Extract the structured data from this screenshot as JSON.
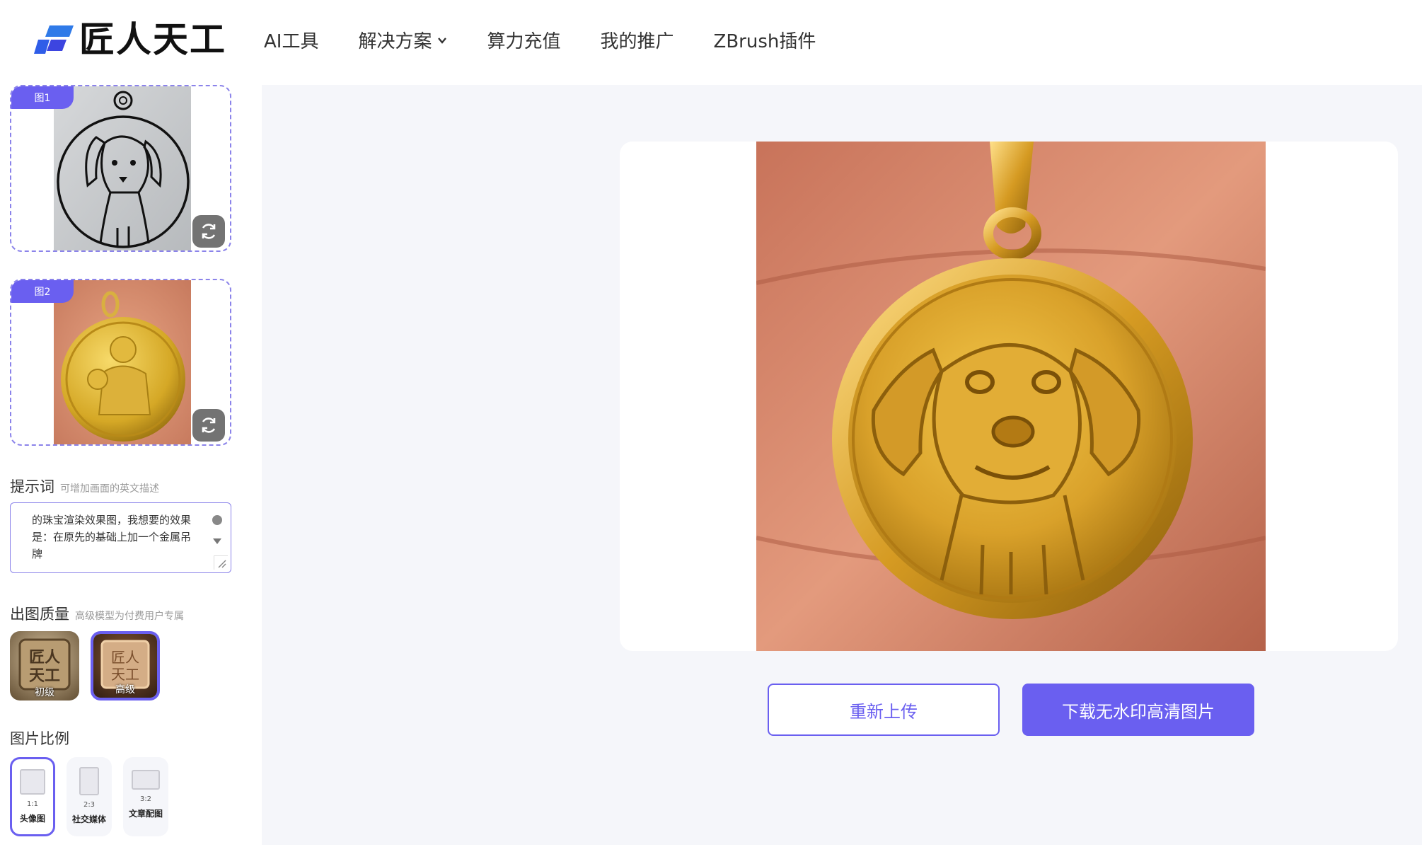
{
  "brand": {
    "name": "匠人天工",
    "accent": "#6a5ff0"
  },
  "nav": {
    "items": [
      "AI工具",
      "解决方案",
      "算力充值",
      "我的推广",
      "ZBrush插件"
    ]
  },
  "uploads": [
    {
      "tag": "图1",
      "image": "dog sketch pendant"
    },
    {
      "tag": "图2",
      "image": "gold religious medal"
    }
  ],
  "prompt": {
    "title": "提示词",
    "hint": "可增加画面的英文描述",
    "text": "的珠宝渲染效果图，我想要的效果是：在原先的基础上加一个金属吊牌"
  },
  "quality": {
    "title": "出图质量",
    "hint": "高级模型为付费用户专属",
    "options": [
      {
        "label": "初级",
        "selected": false
      },
      {
        "label": "高级",
        "selected": true
      }
    ]
  },
  "ratio": {
    "title": "图片比例",
    "options": [
      {
        "ratio": "1:1",
        "label": "头像图",
        "selected": true
      },
      {
        "ratio": "2:3",
        "label": "社交媒体",
        "selected": false
      },
      {
        "ratio": "3:2",
        "label": "文章配图",
        "selected": false
      }
    ]
  },
  "actions": {
    "reupload": "重新上传",
    "download": "下载无水印高清图片"
  }
}
